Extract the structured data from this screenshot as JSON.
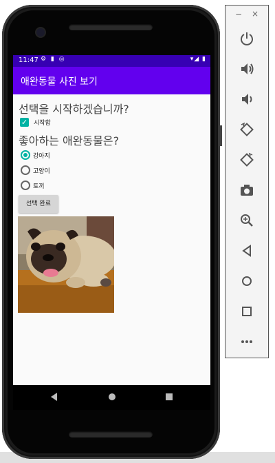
{
  "status_bar": {
    "time": "11:47",
    "left_icons": "⚙ ▮ ◎",
    "right_icons": "▾◢ ▮"
  },
  "app_bar": {
    "title": "애완동물 사진 보기"
  },
  "form": {
    "question_start": "선택을 시작하겠습니까?",
    "start_checkbox_label": "시작함",
    "start_checked": true,
    "question_pet": "좋아하는 애완동물은?",
    "options": [
      {
        "label": "강아지",
        "selected": true
      },
      {
        "label": "고양이",
        "selected": false
      },
      {
        "label": "토끼",
        "selected": false
      }
    ],
    "done_button": "선택 완료"
  },
  "colors": {
    "status_bar": "#3700b3",
    "app_bar": "#6200ee",
    "accent": "#00b3a4"
  },
  "toolbar": {
    "minimize": "−",
    "close": "×",
    "buttons": [
      "power-icon",
      "volume-up-icon",
      "volume-down-icon",
      "rotate-left-icon",
      "rotate-right-icon",
      "camera-icon",
      "zoom-icon",
      "back-icon",
      "home-icon",
      "overview-icon",
      "more-icon"
    ]
  }
}
